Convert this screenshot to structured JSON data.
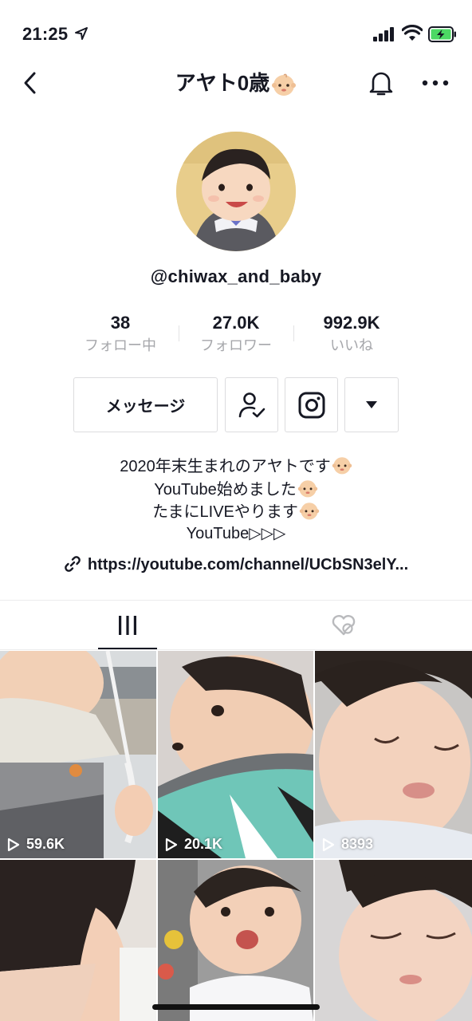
{
  "status_bar": {
    "time": "21:25"
  },
  "nav": {
    "title": "アヤト0歳"
  },
  "profile": {
    "username": "@chiwax_and_baby",
    "stats": [
      {
        "value": "38",
        "label": "フォロー中"
      },
      {
        "value": "27.0K",
        "label": "フォロワー"
      },
      {
        "value": "992.9K",
        "label": "いいね"
      }
    ],
    "message_label": "メッセージ",
    "bio": [
      "2020年末生まれのアヤトです",
      "YouTube始めました",
      "たまにLIVEやります",
      "YouTube▷▷▷"
    ],
    "link": "https://youtube.com/channel/UCbSN3elY..."
  },
  "videos": [
    {
      "views": "59.6K"
    },
    {
      "views": "20.1K"
    },
    {
      "views": "8393"
    },
    {
      "views": ""
    },
    {
      "views": ""
    },
    {
      "views": ""
    }
  ],
  "colors": {
    "text": "#161823",
    "muted": "#a6a7ab",
    "battery": "#4cd964"
  }
}
